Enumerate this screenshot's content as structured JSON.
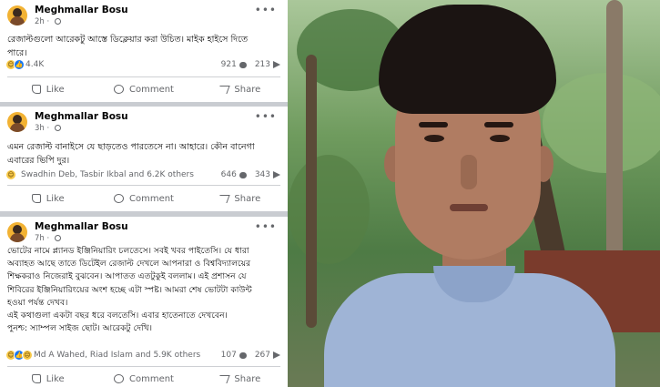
{
  "posts": [
    {
      "author": "Meghmallar Bosu",
      "time": "2h",
      "lines": [
        "রেজাল্টগুলো আরেকটু আস্তে ডিক্লেয়ার করা উচিত। মাইক হাইসে দিতে",
        "পারে।"
      ],
      "reaction_count": "4.4K",
      "comments": "921",
      "shares": "213"
    },
    {
      "author": "Meghmallar Bosu",
      "time": "3h",
      "lines": [
        "এমন রেজাল্ট বানাইসে যে ছাড়তেও পারতেসে না। আহারে। কৌন বানেগা",
        "এবারের ভিপি দুর।"
      ],
      "reaction_count": "Swadhin Deb, Tasbir Ikbal and 6.2K others",
      "comments": "646",
      "shares": "343"
    },
    {
      "author": "Meghmallar Bosu",
      "time": "7h",
      "lines": [
        "ভোটের নামে প্ল্যানড ইঞ্জিনিয়ারিং চলতেসে। সবই খবর পাইতেসি। যে ধারা",
        "অব্যাহত আছে তাতে ডিটেইল রেজাল্ট দেখলে আপনারা ও বিশ্ববিদ্যালয়ের",
        "শিক্ষকরাও নিজেরাই বুঝবেন। আপাতত এতটুকুই বললাম। এই প্রশাসন যে",
        "শিবিরের ইঞ্জিনিয়ারিংয়ের অংশ হচ্ছে এটা স্পষ্ট। আমরা শেষ ভোটটা কাউন্ট",
        "হওয়া পর্যন্ত দেখব।",
        "এই কথাগুলা একটা বছর ধরে বলতেসি। এবার হাতেনাতে দেখবেন।",
        "পুনশ্চ: স্যাম্পল সাইজ ছোট। আরেকটু দেখি।"
      ],
      "reaction_count": "Md A Wahed, Riad Islam and 5.9K others",
      "comments": "107",
      "shares": "267"
    }
  ],
  "actions": {
    "like": "Like",
    "comment": "Comment",
    "share": "Share"
  },
  "icons": {
    "globe": "globe-icon",
    "more": "more-options-icon"
  },
  "colors": {
    "like_blue": "#1877f2",
    "love_red": "#f33e58",
    "haha_yellow": "#f7c948",
    "muted": "#65676b"
  }
}
